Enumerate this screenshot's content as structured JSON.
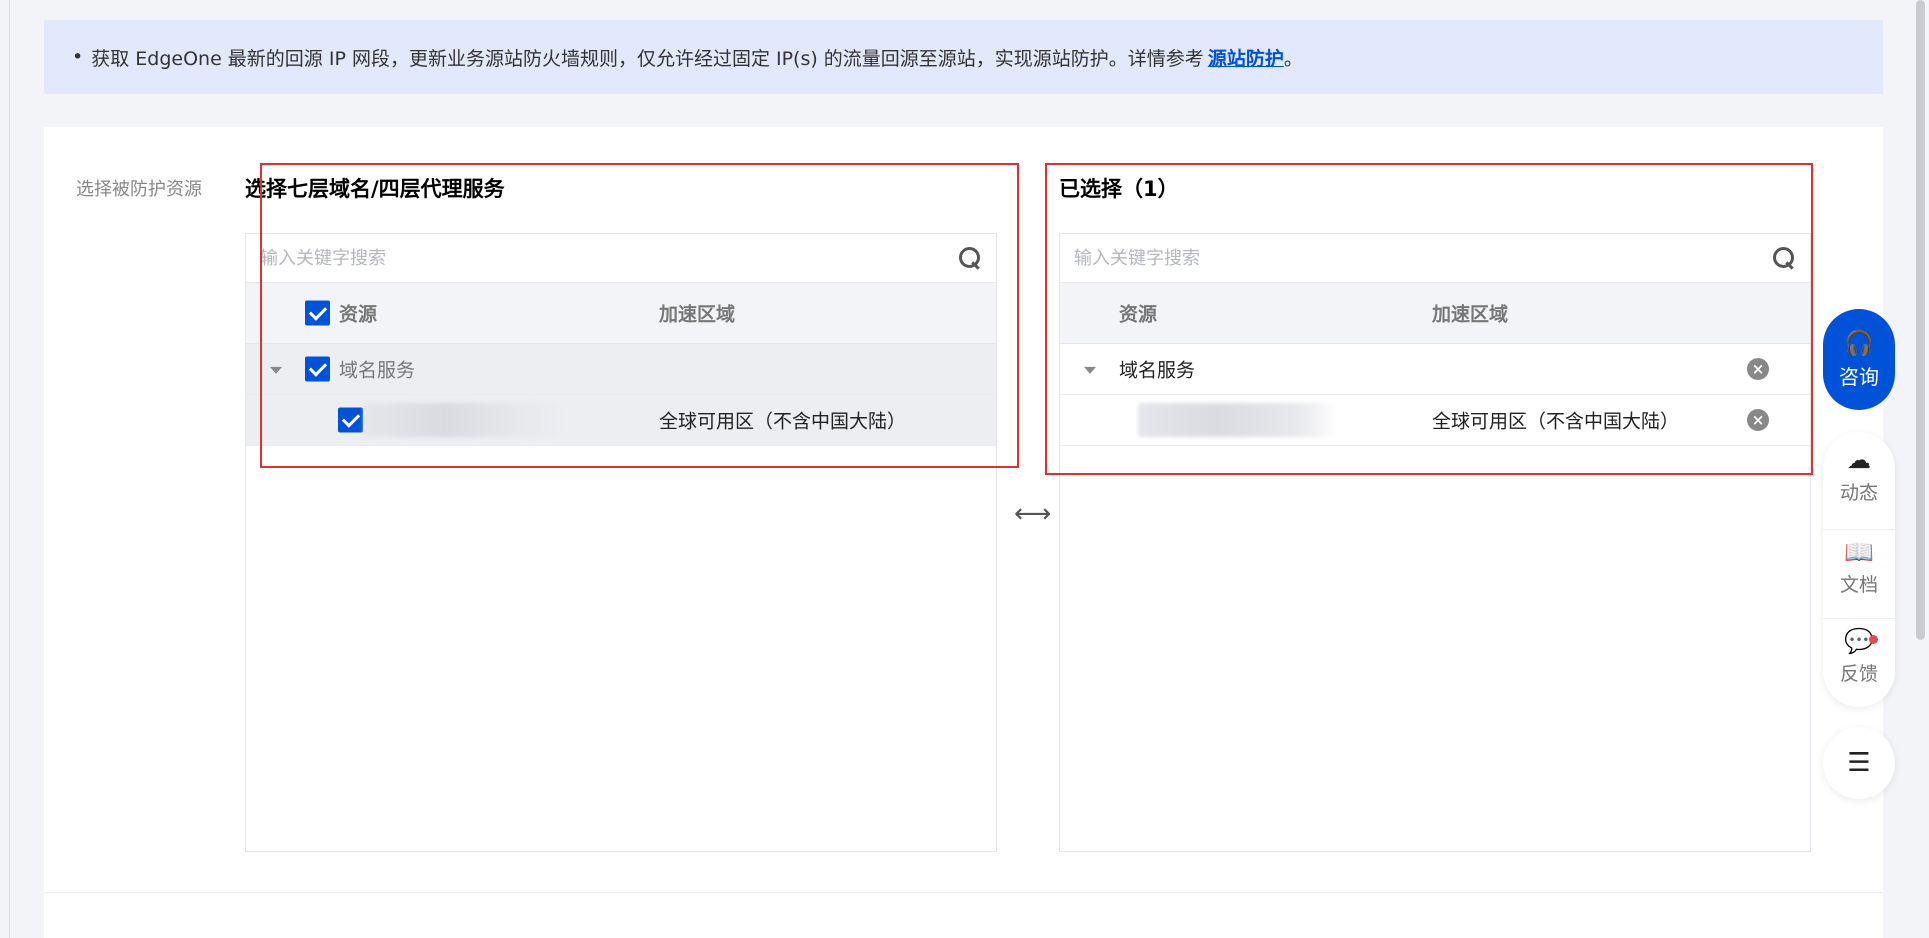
{
  "notice": {
    "bullet": "•",
    "text": "获取 EdgeOne 最新的回源 IP 网段，更新业务源站防火墙规则，仅允许经过固定 IP(s) 的流量回源至源站，实现源站防护。详情参考",
    "link": "源站防护",
    "suffix": "。"
  },
  "form": {
    "label": "选择被防护资源"
  },
  "left_panel": {
    "title": "选择七层域名/四层代理服务",
    "search_placeholder": "输入关键字搜索",
    "columns": [
      "资源",
      "加速区域"
    ],
    "group": {
      "name": "域名服务",
      "checked": true
    },
    "item": {
      "region": "全球可用区（不含中国大陆）",
      "checked": true
    }
  },
  "right_panel": {
    "title": "已选择（1）",
    "search_placeholder": "输入关键字搜索",
    "columns": [
      "资源",
      "加速区域"
    ],
    "group": {
      "name": "域名服务"
    },
    "item": {
      "region": "全球可用区（不含中国大陆）"
    }
  },
  "toolbar": {
    "consult": "咨询",
    "news": "动态",
    "docs": "文档",
    "feedback": "反馈"
  },
  "colors": {
    "primary": "#0052d9",
    "notice_bg": "#e3e9fc",
    "highlight_box": "#e03131"
  }
}
